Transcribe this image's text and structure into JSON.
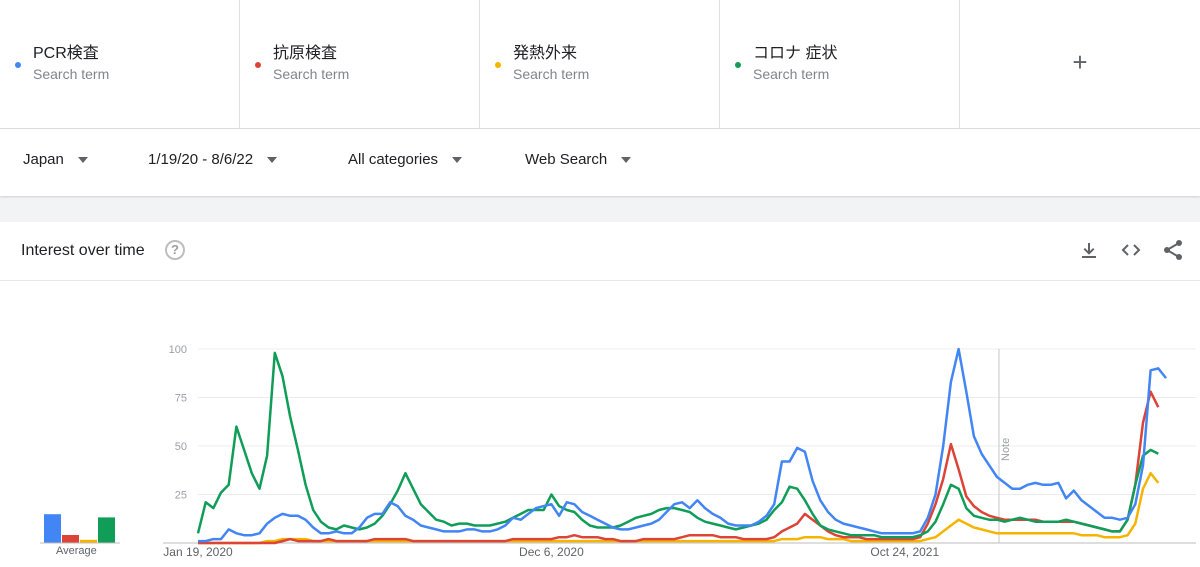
{
  "terms": [
    {
      "name": "PCR検査",
      "sub": "Search term",
      "color": "#4285f4"
    },
    {
      "name": "抗原検査",
      "sub": "Search term",
      "color": "#db4437"
    },
    {
      "name": "発熱外来",
      "sub": "Search term",
      "color": "#f4b400"
    },
    {
      "name": "コロナ 症状",
      "sub": "Search term",
      "color": "#0f9d58"
    }
  ],
  "add_term_label": "+",
  "filters": {
    "region": "Japan",
    "date_range": "1/19/20 - 8/6/22",
    "category": "All categories",
    "search_type": "Web Search"
  },
  "card": {
    "title": "Interest over time",
    "help_icon": "?",
    "icons": [
      "download-icon",
      "embed-icon",
      "share-icon"
    ]
  },
  "average": {
    "label": "Average",
    "values": [
      18,
      5,
      2,
      16
    ]
  },
  "chart_data": {
    "type": "line",
    "ylim": [
      0,
      100
    ],
    "yticks": [
      "100",
      "75",
      "50",
      "25"
    ],
    "xticks": [
      {
        "label": "Jan 19, 2020",
        "index": 0
      },
      {
        "label": "Dec 6, 2020",
        "index": 46
      },
      {
        "label": "Oct 24, 2021",
        "index": 92
      }
    ],
    "note": {
      "label": "Note",
      "index": 104
    },
    "series": [
      {
        "name": "PCR検査",
        "color": "#4285f4",
        "values": [
          1,
          1,
          2,
          2,
          7,
          5,
          4,
          4,
          5,
          10,
          13,
          15,
          14,
          14,
          12,
          8,
          5,
          5,
          6,
          5,
          5,
          8,
          13,
          15,
          15,
          21,
          19,
          14,
          12,
          9,
          8,
          7,
          6,
          6,
          6,
          7,
          7,
          6,
          6,
          7,
          9,
          13,
          12,
          15,
          18,
          19,
          20,
          14,
          21,
          20,
          16,
          14,
          12,
          10,
          8,
          7,
          7,
          8,
          9,
          10,
          12,
          16,
          20,
          21,
          18,
          22,
          18,
          15,
          13,
          10,
          9,
          9,
          9,
          11,
          14,
          20,
          42,
          42,
          49,
          47,
          32,
          22,
          16,
          12,
          10,
          9,
          8,
          7,
          6,
          5,
          5,
          5,
          5,
          5,
          6,
          13,
          25,
          50,
          83,
          100,
          78,
          55,
          46,
          40,
          34,
          31,
          28,
          28,
          30,
          31,
          30,
          30,
          31,
          23,
          27,
          22,
          19,
          16,
          13,
          13,
          12,
          13,
          20,
          40,
          89,
          90,
          85
        ]
      },
      {
        "name": "抗原検査",
        "color": "#db4437",
        "values": [
          0,
          0,
          0,
          0,
          0,
          0,
          0,
          0,
          0,
          0,
          0,
          1,
          2,
          1,
          1,
          1,
          1,
          2,
          1,
          1,
          1,
          1,
          1,
          2,
          2,
          2,
          2,
          2,
          1,
          1,
          1,
          1,
          1,
          1,
          1,
          1,
          1,
          1,
          1,
          1,
          1,
          2,
          2,
          2,
          2,
          2,
          2,
          3,
          3,
          4,
          3,
          3,
          3,
          2,
          2,
          1,
          1,
          1,
          2,
          2,
          2,
          2,
          2,
          3,
          4,
          4,
          4,
          4,
          3,
          3,
          3,
          2,
          2,
          2,
          2,
          3,
          6,
          8,
          10,
          15,
          12,
          9,
          6,
          4,
          3,
          3,
          3,
          2,
          2,
          2,
          2,
          2,
          2,
          2,
          3,
          10,
          20,
          33,
          51,
          38,
          24,
          19,
          16,
          14,
          13,
          12,
          12,
          12,
          12,
          12,
          11,
          11,
          11,
          11,
          11,
          10,
          9,
          8,
          7,
          6,
          6,
          12,
          30,
          62,
          78,
          70
        ]
      },
      {
        "name": "発熱外来",
        "color": "#f4b400",
        "values": [
          0,
          0,
          0,
          0,
          0,
          0,
          0,
          0,
          0,
          1,
          1,
          2,
          2,
          2,
          2,
          1,
          1,
          1,
          1,
          1,
          1,
          1,
          1,
          1,
          1,
          1,
          1,
          1,
          1,
          1,
          1,
          1,
          1,
          1,
          1,
          1,
          1,
          1,
          1,
          1,
          1,
          1,
          1,
          1,
          1,
          1,
          1,
          1,
          1,
          1,
          1,
          1,
          1,
          1,
          1,
          1,
          1,
          1,
          1,
          1,
          1,
          1,
          1,
          1,
          1,
          1,
          1,
          1,
          1,
          1,
          1,
          1,
          1,
          1,
          1,
          1,
          2,
          2,
          2,
          3,
          3,
          3,
          2,
          2,
          2,
          1,
          1,
          1,
          1,
          1,
          1,
          1,
          1,
          1,
          1,
          2,
          3,
          6,
          9,
          12,
          10,
          8,
          7,
          6,
          5,
          5,
          5,
          5,
          5,
          5,
          5,
          5,
          5,
          5,
          5,
          4,
          4,
          4,
          3,
          3,
          3,
          4,
          10,
          28,
          36,
          31
        ]
      },
      {
        "name": "コロナ 症状",
        "color": "#0f9d58",
        "values": [
          5,
          21,
          18,
          26,
          30,
          60,
          48,
          36,
          28,
          45,
          98,
          86,
          65,
          48,
          30,
          17,
          11,
          8,
          7,
          9,
          8,
          7,
          8,
          10,
          14,
          20,
          27,
          36,
          28,
          20,
          16,
          12,
          11,
          9,
          10,
          10,
          9,
          9,
          9,
          10,
          11,
          13,
          15,
          17,
          17,
          17,
          25,
          19,
          17,
          16,
          12,
          9,
          8,
          8,
          8,
          9,
          11,
          13,
          14,
          15,
          17,
          18,
          18,
          17,
          16,
          13,
          11,
          10,
          9,
          8,
          7,
          8,
          9,
          10,
          12,
          17,
          21,
          29,
          28,
          22,
          15,
          9,
          7,
          6,
          5,
          4,
          4,
          4,
          4,
          3,
          3,
          3,
          3,
          3,
          4,
          6,
          11,
          20,
          30,
          28,
          18,
          14,
          13,
          12,
          12,
          11,
          12,
          13,
          12,
          11,
          11,
          11,
          11,
          12,
          11,
          10,
          9,
          8,
          7,
          6,
          6,
          12,
          30,
          45,
          48,
          46
        ]
      }
    ]
  }
}
